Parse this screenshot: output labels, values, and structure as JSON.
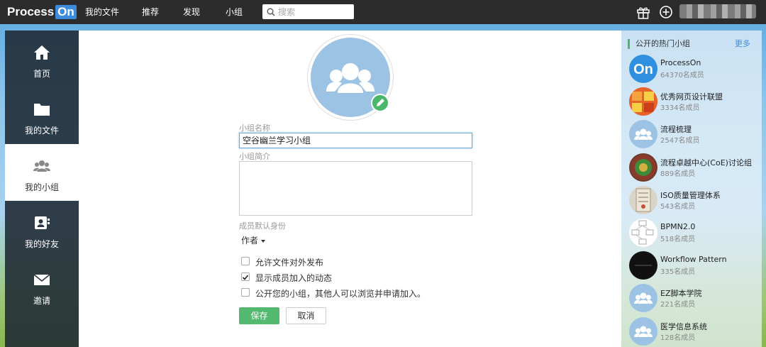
{
  "topbar": {
    "logo_text": "Process",
    "logo_on": "On",
    "nav": [
      "我的文件",
      "推荐",
      "发现",
      "小组"
    ],
    "search_placeholder": "搜索",
    "icons": [
      "gift-icon",
      "plus-circle-icon"
    ]
  },
  "sidebar": {
    "items": [
      {
        "label": "首页",
        "icon": "home-icon"
      },
      {
        "label": "我的文件",
        "icon": "folder-icon"
      },
      {
        "label": "我的小组",
        "icon": "group-icon",
        "active": true
      },
      {
        "label": "我的好友",
        "icon": "contact-card-icon"
      },
      {
        "label": "邀请",
        "icon": "envelope-icon"
      }
    ]
  },
  "form": {
    "name_label": "小组名称",
    "name_value": "空谷幽兰学习小组",
    "intro_label": "小组简介",
    "intro_value": "",
    "role_label": "成员默认身份",
    "role_value": "作者",
    "options": [
      {
        "label": "允许文件对外发布",
        "checked": false
      },
      {
        "label": "显示成员加入的动态",
        "checked": true
      },
      {
        "label": "公开您的小组，其他人可以浏览并申请加入。",
        "checked": false
      }
    ],
    "save_label": "保存",
    "cancel_label": "取消"
  },
  "hot_groups": {
    "title": "公开的热门小组",
    "more_label": "更多",
    "items": [
      {
        "name": "ProcessOn",
        "members": "64370名成员"
      },
      {
        "name": "优秀网页设计联盟",
        "members": "3334名成员"
      },
      {
        "name": "流程梳理",
        "members": "2547名成员"
      },
      {
        "name": "流程卓越中心(CoE)讨论组",
        "members": "889名成员"
      },
      {
        "name": "ISO质量管理体系",
        "members": "543名成员"
      },
      {
        "name": "BPMN2.0",
        "members": "518名成员"
      },
      {
        "name": "Workflow Pattern",
        "members": "335名成员"
      },
      {
        "name": "EZ脚本学院",
        "members": "221名成员"
      },
      {
        "name": "医学信息系统",
        "members": "128名成员"
      }
    ]
  },
  "colors": {
    "accent_green": "#52b96e",
    "brand_blue": "#3c8cde",
    "topbar": "#2c2c2c"
  }
}
